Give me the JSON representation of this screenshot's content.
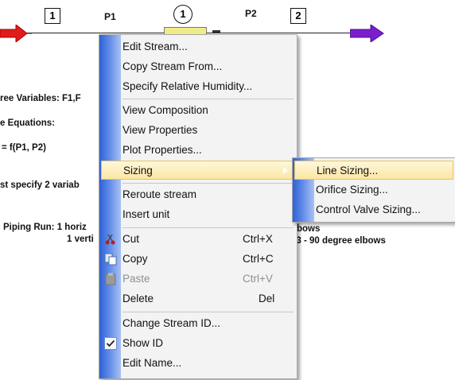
{
  "diagram": {
    "inlet_box_label": "1",
    "outlet_box_label": "2",
    "pump_label": "1",
    "p1_label": "P1",
    "p2_label": "P2",
    "colors": {
      "inlet_arrow": "#e01b1b",
      "outlet_arrow": "#7a1ed0",
      "pump_body": "#f1ec8a"
    }
  },
  "background_text": {
    "free_variables": "ree Variables: F1,F",
    "equations": "e Equations:",
    "function": "= f(P1, P2)",
    "specify": "st specify 2 variab",
    "piping_run_1": "Piping Run: 1 horiz",
    "piping_run_2": "1 verti",
    "elbows_1": "bows",
    "elbows_2": "l 3 - 90 degree elbows"
  },
  "context_menu": {
    "items": [
      {
        "label": "Edit Stream..."
      },
      {
        "label": "Copy Stream From..."
      },
      {
        "label": "Specify Relative Humidity..."
      },
      {
        "label": "View Composition"
      },
      {
        "label": "View Properties"
      },
      {
        "label": "Plot Properties..."
      },
      {
        "label": "Sizing"
      },
      {
        "label": "Reroute stream"
      },
      {
        "label": "Insert unit"
      },
      {
        "label": "Cut",
        "shortcut": "Ctrl+X",
        "icon": "scissors-icon"
      },
      {
        "label": "Copy",
        "shortcut": "Ctrl+C",
        "icon": "copy-icon"
      },
      {
        "label": "Paste",
        "shortcut": "Ctrl+V",
        "icon": "paste-icon",
        "disabled": true
      },
      {
        "label": "Delete",
        "shortcut": "Del"
      },
      {
        "label": "Change Stream ID..."
      },
      {
        "label": "Show ID",
        "checked": true,
        "icon": "checkmark-icon"
      },
      {
        "label": "Edit Name..."
      }
    ],
    "highlighted": "Sizing"
  },
  "submenu": {
    "items": [
      {
        "label": "Line Sizing..."
      },
      {
        "label": "Orifice Sizing..."
      },
      {
        "label": "Control Valve Sizing..."
      }
    ],
    "highlighted": "Line Sizing..."
  }
}
